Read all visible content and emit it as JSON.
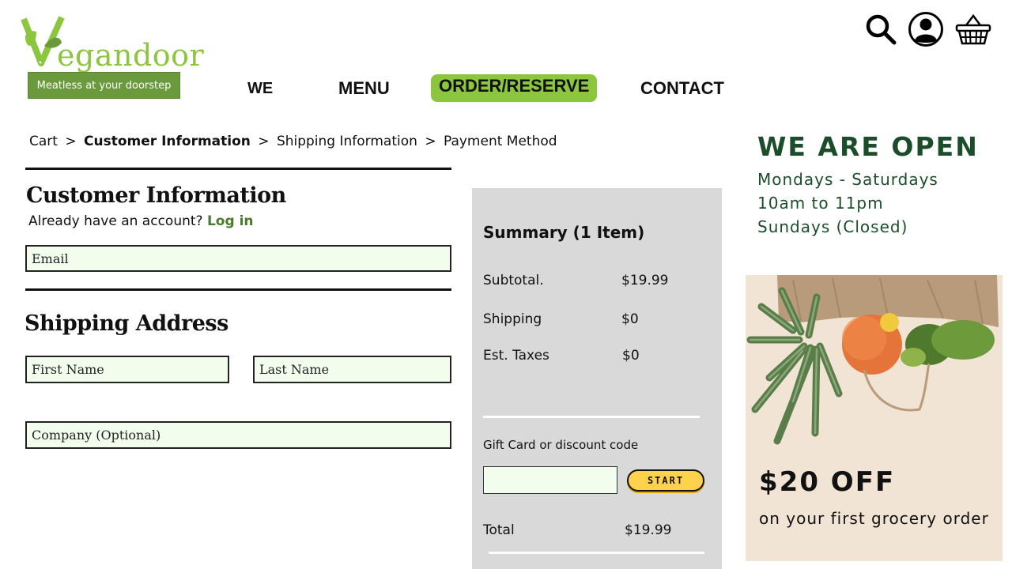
{
  "brand": {
    "logo_initial": "V",
    "logo_rest": "egandoor",
    "tagline": "Meatless at your doorstep",
    "color_primary": "#8cc63f",
    "color_dark_green": "#1b4d2a"
  },
  "icons": [
    "search-icon",
    "user-account-icon",
    "shopping-basket-icon"
  ],
  "nav": {
    "we": "WE",
    "menu": "MENU",
    "order": "ORDER/RESERVE",
    "contact": "CONTACT"
  },
  "breadcrumb": {
    "cart": "Cart",
    "customer": "Customer Information",
    "shipping": "Shipping Information",
    "payment": "Payment Method",
    "separator": ">"
  },
  "customer": {
    "title": "Customer Information",
    "account_prompt": "Already have an account?",
    "login_label": "Log in",
    "email_placeholder": "Email"
  },
  "shipping": {
    "title": "Shipping Address",
    "first_name_placeholder": "First Name",
    "last_name_placeholder": "Last Name",
    "company_placeholder": "Company (Optional)"
  },
  "summary": {
    "title": "Summary (1 Item)",
    "subtotal_label": "Subtotal.",
    "subtotal_value": "$19.99",
    "shipping_label": "Shipping",
    "shipping_value": "$0",
    "taxes_label": "Est. Taxes",
    "taxes_value": "$0",
    "gift_label": "Gift Card or discount code",
    "start_label": "START",
    "total_label": "Total",
    "total_value": "$19.99"
  },
  "hours": {
    "title": "WE ARE OPEN",
    "line1": "Mondays - Saturdays",
    "line2": "10am to 11pm",
    "line3": "Sundays (Closed)"
  },
  "promo": {
    "title": "$20 OFF",
    "subtitle": "on your first grocery order"
  }
}
